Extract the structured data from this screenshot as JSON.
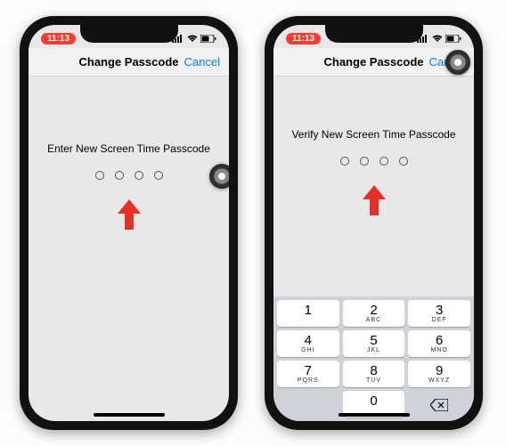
{
  "status": {
    "time": "11:13",
    "signal": "••ıl",
    "wifi": "wifi",
    "battery": "60"
  },
  "nav": {
    "title": "Change Passcode",
    "cancel": "Cancel"
  },
  "phone1": {
    "prompt": "Enter New Screen Time Passcode"
  },
  "phone2": {
    "prompt": "Verify New Screen Time Passcode"
  },
  "colors": {
    "arrow": "#e53028",
    "link": "#007aff",
    "timepill": "#ff3a2f"
  },
  "keypad": {
    "keys": [
      {
        "num": "1",
        "letters": ""
      },
      {
        "num": "2",
        "letters": "ABC"
      },
      {
        "num": "3",
        "letters": "DEF"
      },
      {
        "num": "4",
        "letters": "GHI"
      },
      {
        "num": "5",
        "letters": "JKL"
      },
      {
        "num": "6",
        "letters": "MNO"
      },
      {
        "num": "7",
        "letters": "PQRS"
      },
      {
        "num": "8",
        "letters": "TUV"
      },
      {
        "num": "9",
        "letters": "WXYZ"
      },
      {
        "num": "",
        "letters": "",
        "blank": true
      },
      {
        "num": "0",
        "letters": ""
      },
      {
        "num": "del",
        "letters": "",
        "del": true
      }
    ]
  }
}
